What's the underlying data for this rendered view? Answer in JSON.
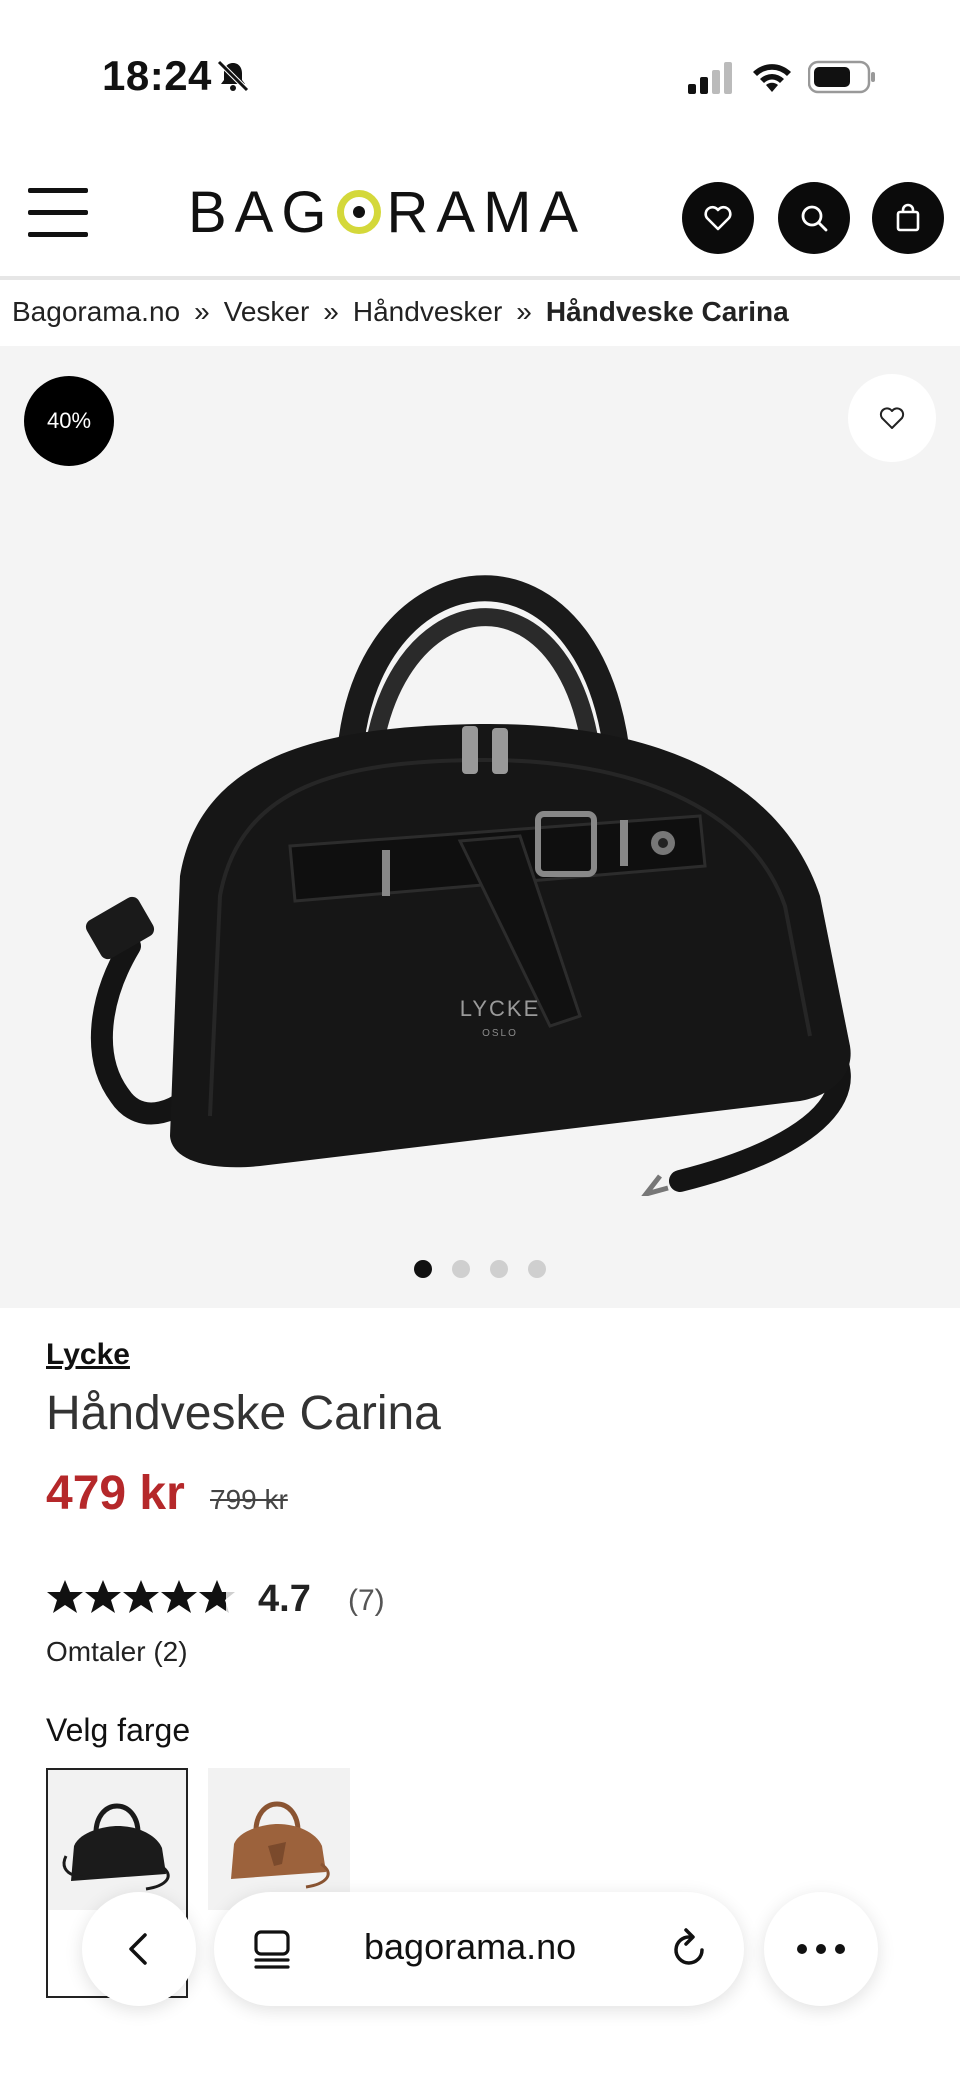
{
  "status_bar": {
    "time": "18:24"
  },
  "header": {
    "brand_logo": "BAGORAMA"
  },
  "breadcrumb": [
    "Bagorama.no",
    "Vesker",
    "Håndvesker",
    "Håndveske Carina"
  ],
  "breadcrumb_separator": "»",
  "gallery": {
    "discount_badge": "40%",
    "image_count": 4,
    "active_index": 0
  },
  "product": {
    "brand": "Lycke",
    "title": "Håndveske Carina",
    "price": "479 kr",
    "old_price": "799 kr",
    "rating": "4.7",
    "rating_count": "(7)",
    "rating_stars_value": 4.7,
    "reviews_link": "Omtaler (2)",
    "color_label": "Velg farge",
    "colors": [
      "black",
      "brown"
    ],
    "bag_logo": "LYCKE",
    "bag_logo_sub": "OSLO"
  },
  "browser": {
    "url": "bagorama.no"
  },
  "icons": {
    "menu": "hamburger-icon",
    "wishlist": "heart-icon",
    "search": "search-icon",
    "cart": "shopping-bag-icon",
    "back": "chevron-left-icon",
    "tabs": "tabs-icon",
    "reload": "reload-icon",
    "more": "more-icon"
  },
  "colors": {
    "price_red": "#b5282a",
    "logo_accent": "#d4d83a",
    "badge_black": "#000000"
  }
}
